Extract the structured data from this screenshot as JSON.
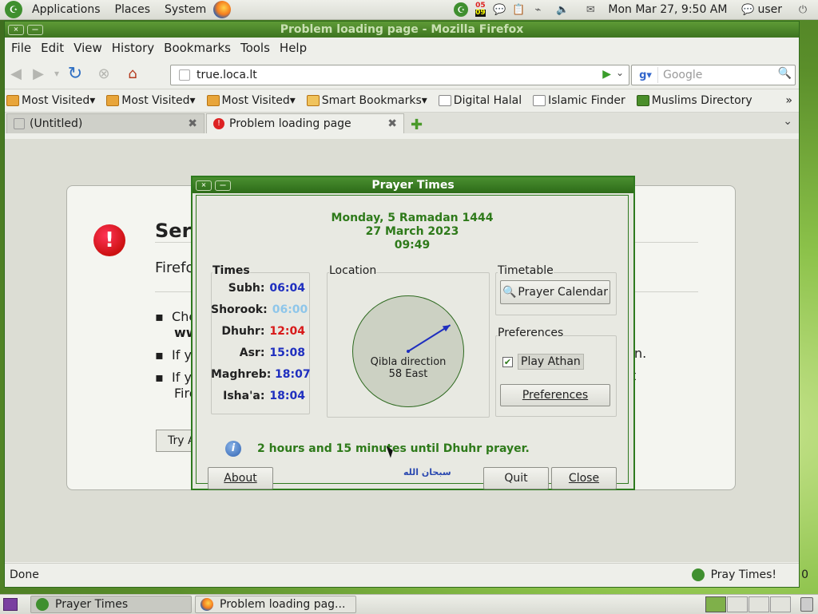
{
  "top_panel": {
    "menus": [
      "Applications",
      "Places",
      "System"
    ],
    "tray_badge_top": "05",
    "tray_badge_bottom": "09",
    "clock": "Mon Mar 27,  9:50 AM",
    "user": "user"
  },
  "firefox": {
    "title": "Problem loading page - Mozilla Firefox",
    "menu": [
      "File",
      "Edit",
      "View",
      "History",
      "Bookmarks",
      "Tools",
      "Help"
    ],
    "url": "true.loca.lt",
    "search_placeholder": "Google",
    "bookmarks": [
      "Most Visited",
      "Most Visited",
      "Most Visited",
      "Smart Bookmarks",
      "Digital Halal",
      "Islamic Finder",
      "Muslims Directory"
    ],
    "bookmarks_overflow": "»",
    "tabs": [
      "(Untitled)",
      "Problem loading page"
    ],
    "error": {
      "title_fragment": "Serv",
      "subtitle_fragment": "Firefo",
      "bullet1_a": "Che",
      "bullet1_b": "ww",
      "bullet2": "If y",
      "bullet3_a": "If y",
      "bullet3_b": "Fire",
      "bullet2_end": "n.",
      "bullet3_end": "t",
      "try_button": "Try A"
    },
    "status": "Done",
    "status_right": "Pray Times!",
    "status_edge": "0"
  },
  "prayer_dialog": {
    "title": "Prayer Times",
    "hijri_date": "Monday, 5 Ramadan 1444",
    "gregorian_date": "27 March 2023",
    "time": "09:49",
    "times_label": "Times",
    "times": [
      {
        "name": "Subh:",
        "value": "06:04",
        "color": "#1f2fbf"
      },
      {
        "name": "Shorook:",
        "value": "06:00",
        "color": "#8ec6ea"
      },
      {
        "name": "Dhuhr:",
        "value": "12:04",
        "color": "#d81a1a"
      },
      {
        "name": "Asr:",
        "value": "15:08",
        "color": "#1f2fbf"
      },
      {
        "name": "Maghreb:",
        "value": "18:07",
        "color": "#1f2fbf"
      },
      {
        "name": "Isha'a:",
        "value": "18:04",
        "color": "#1f2fbf"
      }
    ],
    "location_label": "Location",
    "qibla_label": "Qibla direction",
    "qibla_value": "58 East",
    "timetable_label": "Timetable",
    "prayer_calendar_button": "Prayer Calendar",
    "preferences_label": "Preferences",
    "play_athan_label": "Play Athan",
    "play_athan_checked": true,
    "preferences_button": "Preferences",
    "next_prayer_message": "2 hours and 15 minutes until Dhuhr prayer.",
    "subhanallah": "سبحان الله",
    "about_button": "About",
    "quit_button": "Quit",
    "close_button": "Close"
  },
  "bottom_panel": {
    "tasks": [
      "Prayer Times",
      "Problem loading pag..."
    ]
  },
  "colors": {
    "accent_green": "#2e7a1a",
    "title_green": "#3d7420"
  }
}
